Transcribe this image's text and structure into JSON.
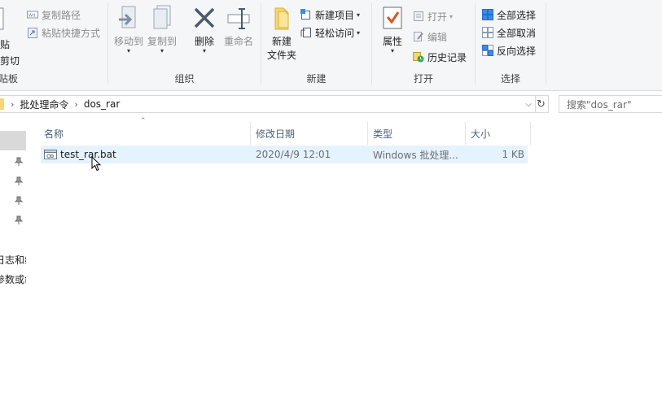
{
  "ribbon": {
    "clipboard": {
      "paste_label": "贴",
      "cut_label": "剪切",
      "copy_path_label": "复制路径",
      "paste_shortcut_label": "粘贴快捷方式",
      "group_label": "贴板"
    },
    "organize": {
      "move_to_label": "移动到",
      "copy_to_label": "复制到",
      "delete_label": "删除",
      "rename_label": "重命名",
      "group_label": "组织"
    },
    "new": {
      "new_folder_line1": "新建",
      "new_folder_line2": "文件夹",
      "new_item_label": "新建项目",
      "easy_access_label": "轻松访问",
      "group_label": "新建"
    },
    "open": {
      "properties_label": "属性",
      "open_label": "打开",
      "edit_label": "编辑",
      "history_label": "历史记录",
      "group_label": "打开"
    },
    "select": {
      "select_all_label": "全部选择",
      "select_none_label": "全部取消",
      "invert_label": "反向选择",
      "group_label": "选择"
    }
  },
  "address": {
    "crumbs": [
      "批处理命令",
      "dos_rar"
    ]
  },
  "search": {
    "placeholder": "搜索\"dos_rar\""
  },
  "nav": {
    "text_line1": "日志和维",
    "text_line2": "参数或命"
  },
  "columns": {
    "name": "名称",
    "modified": "修改日期",
    "type": "类型",
    "size": "大小"
  },
  "files": [
    {
      "name": "test_rar.bat",
      "modified": "2020/4/9 12:01",
      "type": "Windows 批处理...",
      "size": "1 KB"
    }
  ],
  "colors": {
    "ribbon_bg": "#f5f6f7",
    "selected_row": "#e5f3ff",
    "header_text": "#4c607a",
    "accent_blue": "#1e6fd0"
  },
  "icons": {
    "paste": "clipboard-icon",
    "copy_path": "copy-path-icon",
    "paste_shortcut": "paste-shortcut-icon",
    "move_to": "move-to-icon",
    "copy_to": "copy-to-icon",
    "delete": "delete-x-icon",
    "rename": "rename-icon",
    "new_folder": "folder-icon",
    "new_item": "new-item-icon",
    "easy_access": "easy-access-icon",
    "properties": "properties-check-icon",
    "open": "open-icon",
    "edit": "edit-icon",
    "history": "history-icon",
    "select_all": "select-all-icon",
    "select_none": "select-none-icon",
    "invert": "invert-selection-icon",
    "file": "batch-file-icon",
    "pin": "pin-icon"
  }
}
